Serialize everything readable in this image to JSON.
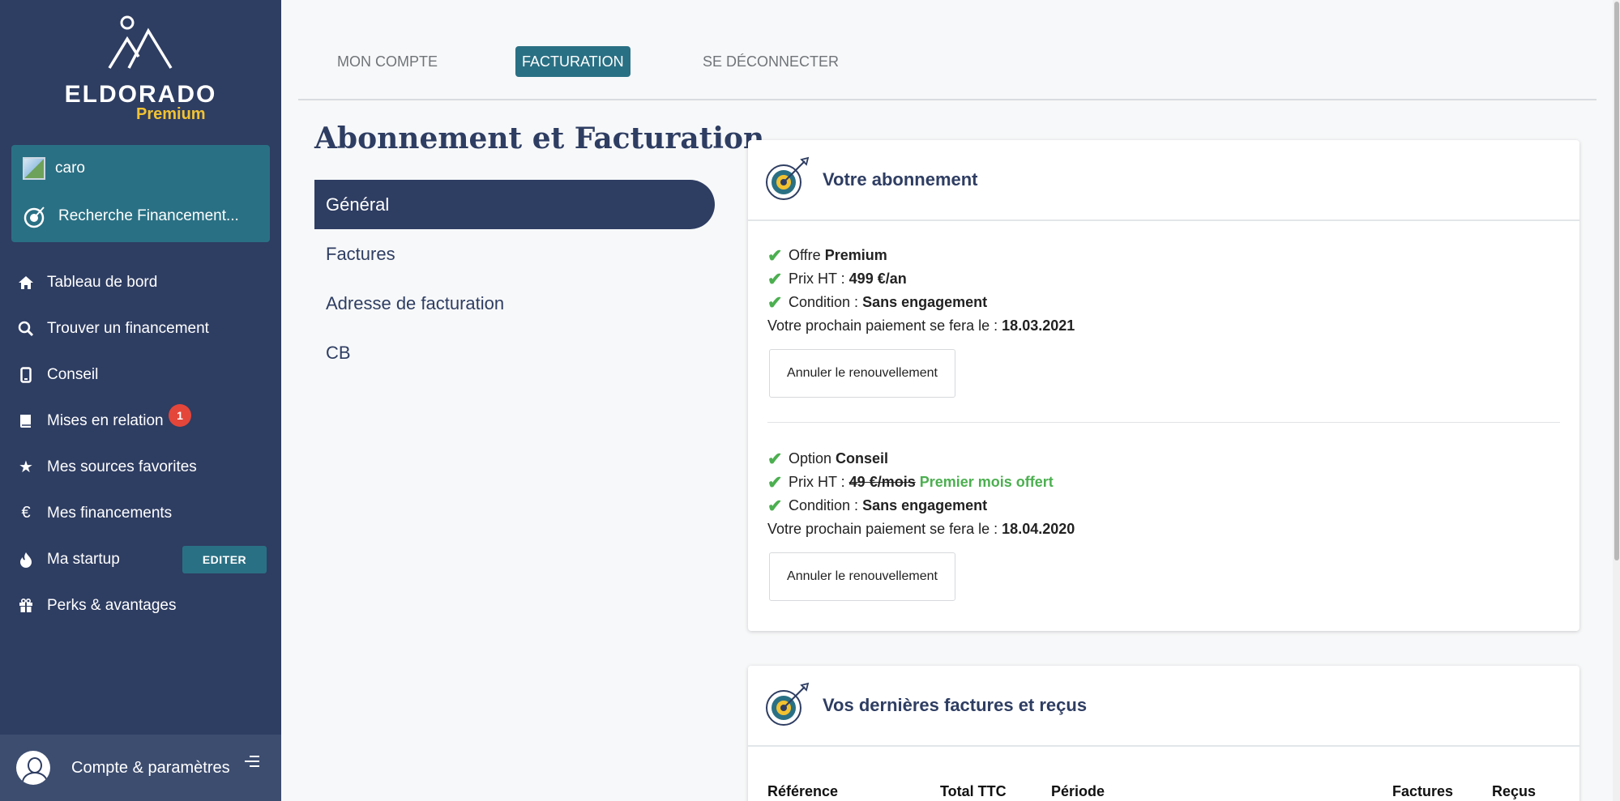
{
  "brand": {
    "name": "ELDORADO",
    "tier": "Premium"
  },
  "user": {
    "name": "caro",
    "project": "Recherche Financement..."
  },
  "nav": {
    "items": [
      {
        "label": "Tableau de bord",
        "icon": "home-icon"
      },
      {
        "label": "Trouver un financement",
        "icon": "search-icon"
      },
      {
        "label": "Conseil",
        "icon": "phone-icon"
      },
      {
        "label": "Mises en relation",
        "icon": "book-icon",
        "badge": "1"
      },
      {
        "label": "Mes sources favorites",
        "icon": "star-icon"
      },
      {
        "label": "Mes financements",
        "icon": "euro-icon"
      },
      {
        "label": "Ma startup",
        "icon": "fire-icon",
        "action": "EDITER"
      },
      {
        "label": "Perks & avantages",
        "icon": "gift-icon"
      }
    ]
  },
  "account": {
    "label": "Compte & paramètres"
  },
  "tabs": {
    "account": "MON COMPTE",
    "billing": "FACTURATION",
    "logout": "SE DÉCONNECTER"
  },
  "page": {
    "title": "Abonnement et Facturation"
  },
  "submenu": {
    "general": "Général",
    "invoices": "Factures",
    "address": "Adresse de facturation",
    "card": "CB"
  },
  "subscription": {
    "title": "Votre abonnement",
    "plan": {
      "offer_label": "Offre",
      "offer_value": "Premium",
      "price_label": "Prix HT :",
      "price_value": "499 €/an",
      "condition_label": "Condition :",
      "condition_value": "Sans engagement",
      "next_label": "Votre prochain paiement se fera le :",
      "next_value": "18.03.2021",
      "cancel": "Annuler le renouvellement"
    },
    "option": {
      "offer_label": "Option",
      "offer_value": "Conseil",
      "price_label": "Prix HT :",
      "price_old": "49 €/mois",
      "price_promo": "Premier mois offert",
      "condition_label": "Condition :",
      "condition_value": "Sans engagement",
      "next_label": "Votre prochain paiement se fera le :",
      "next_value": "18.04.2020",
      "cancel": "Annuler le renouvellement"
    }
  },
  "invoices": {
    "title": "Vos dernières factures et reçus",
    "columns": {
      "ref": "Référence",
      "total": "Total TTC",
      "period": "Période",
      "invoices": "Factures",
      "receipts": "Reçus"
    }
  },
  "colors": {
    "sidebar": "#2e3d62",
    "accent": "#2a7084",
    "gold": "#f2c230",
    "check": "#4caf50",
    "badge": "#e4463a"
  }
}
